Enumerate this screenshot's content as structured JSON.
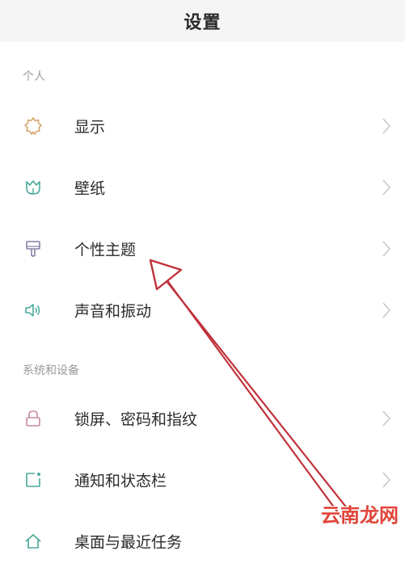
{
  "header": {
    "title": "设置"
  },
  "sections": [
    {
      "label": "个人"
    },
    {
      "label": "系统和设备"
    }
  ],
  "items": [
    {
      "label": "显示",
      "icon": "sun-icon",
      "color": "#d4a56a"
    },
    {
      "label": "壁纸",
      "icon": "tulip-icon",
      "color": "#4aa89b"
    },
    {
      "label": "个性主题",
      "icon": "paintbrush-icon",
      "color": "#8a7fa8"
    },
    {
      "label": "声音和振动",
      "icon": "speaker-icon",
      "color": "#4aa89b"
    },
    {
      "label": "锁屏、密码和指纹",
      "icon": "lock-icon",
      "color": "#c98a9e"
    },
    {
      "label": "通知和状态栏",
      "icon": "notification-icon",
      "color": "#4aa89b"
    },
    {
      "label": "桌面与最近任务",
      "icon": "home-icon",
      "color": "#4aa89b"
    }
  ],
  "watermark": "云南龙网",
  "annotation_color": "#c0313a"
}
